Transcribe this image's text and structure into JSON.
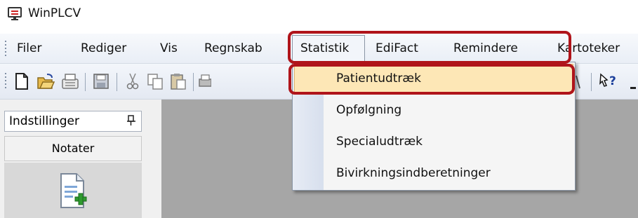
{
  "window": {
    "title": "WinPLCV",
    "icon": "monitor-icon"
  },
  "menubar": {
    "items": [
      {
        "label": "Filer"
      },
      {
        "label": "Rediger"
      },
      {
        "label": "Vis"
      },
      {
        "label": "Regnskab"
      },
      {
        "label": "Statistik",
        "state": "open"
      },
      {
        "label": "EdiFact"
      },
      {
        "label": "Remindere"
      },
      {
        "label": "Kartoteker"
      }
    ]
  },
  "statistik_menu": {
    "items": [
      {
        "label": "Patientudtræk",
        "state": "highlighted"
      },
      {
        "label": "Opfølgning"
      },
      {
        "label": "Specialudtræk"
      },
      {
        "label": "Bivirkningsindberetninger"
      }
    ]
  },
  "toolbar": {
    "icons": [
      "new-document-icon",
      "open-folder-icon",
      "fax-icon",
      "save-icon",
      "cut-icon",
      "copy-icon",
      "paste-icon",
      "print-icon",
      "help-pointer-icon"
    ]
  },
  "leftpane": {
    "header": "Indstillinger",
    "pin_icon": "pin-icon",
    "tab": "Notater",
    "action_icon": "new-note-icon"
  },
  "colors": {
    "highlight_annotation": "#b0141a",
    "selected_item_bg": "#fde7b6",
    "workspace": "#a6a6a6"
  }
}
